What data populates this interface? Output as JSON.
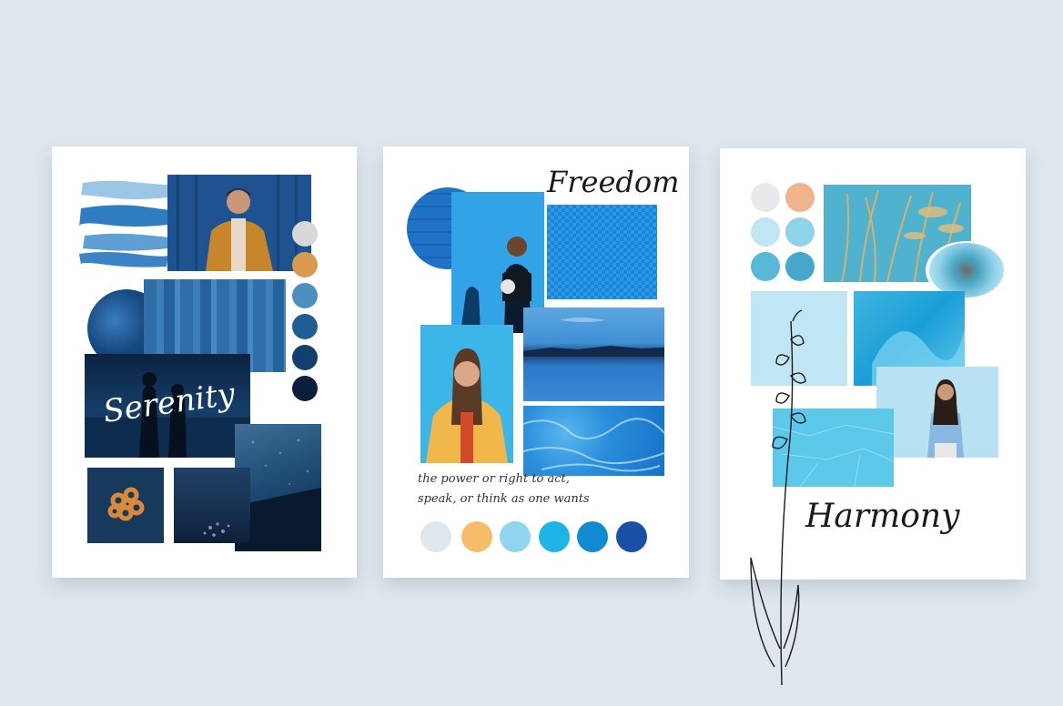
{
  "boards": [
    {
      "title": "Serenity",
      "palette": [
        "#d8d8d8",
        "#d99a4e",
        "#4f8fc0",
        "#1f5e93",
        "#113f6e",
        "#0b1f3d"
      ]
    },
    {
      "title": "Freedom",
      "caption": [
        "the power or right to act,",
        "speak, or think as one wants"
      ],
      "palette": [
        "#dfe6ed",
        "#f5bd68",
        "#8ed6f0",
        "#1fb4e6",
        "#118ad0",
        "#1a4fa6"
      ]
    },
    {
      "title": "Harmony",
      "palette": [
        "#e8e9ec",
        "#f0b48c",
        "#bfe6f2",
        "#8fd3e8",
        "#58b8d8",
        "#47a8cc"
      ]
    }
  ]
}
